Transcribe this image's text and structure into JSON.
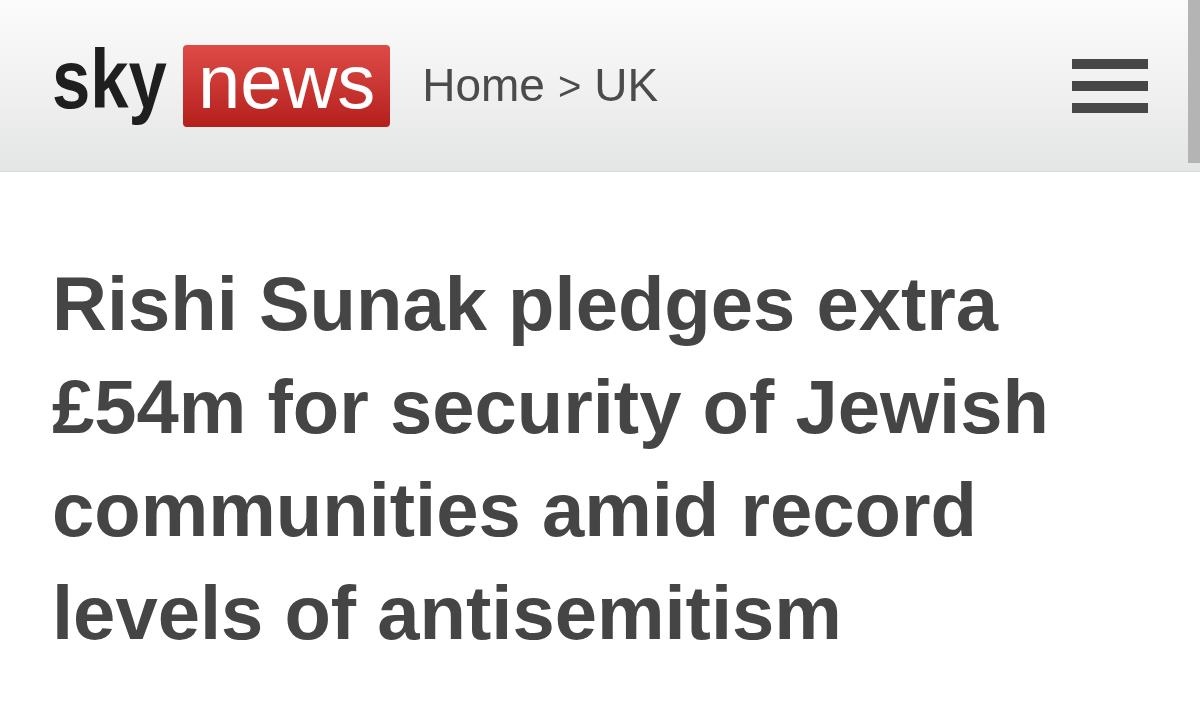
{
  "header": {
    "logo": {
      "word_1": "sky",
      "word_2": "news"
    },
    "breadcrumb": {
      "items": [
        {
          "label": "Home"
        },
        {
          "label": "UK"
        }
      ],
      "separator": ">"
    }
  },
  "article": {
    "headline": "Rishi Sunak pledges extra £54m for security of Jewish communities amid record levels of antisemitism"
  }
}
